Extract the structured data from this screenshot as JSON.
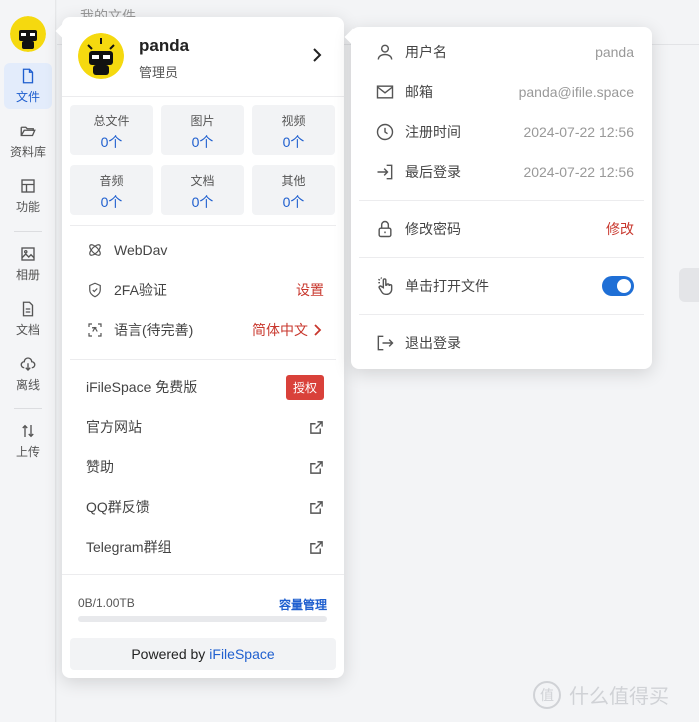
{
  "background": {
    "title_partial": "我的文件"
  },
  "sidebar": {
    "items": [
      {
        "label": "文件",
        "icon": "file-icon",
        "active": true
      },
      {
        "label": "资料库",
        "icon": "folder-open-icon"
      },
      {
        "label": "功能",
        "icon": "layout-icon"
      },
      {
        "label": "相册",
        "icon": "image-icon"
      },
      {
        "label": "文档",
        "icon": "document-icon"
      },
      {
        "label": "离线",
        "icon": "cloud-download-icon"
      },
      {
        "label": "上传",
        "icon": "sort-arrows-icon"
      }
    ]
  },
  "user": {
    "name": "panda",
    "role": "管理员"
  },
  "stats": [
    {
      "label": "总文件",
      "value": "0个"
    },
    {
      "label": "图片",
      "value": "0个"
    },
    {
      "label": "视频",
      "value": "0个"
    },
    {
      "label": "音频",
      "value": "0个"
    },
    {
      "label": "文档",
      "value": "0个"
    },
    {
      "label": "其他",
      "value": "0个"
    }
  ],
  "menu": {
    "webdav": "WebDav",
    "twofa": "2FA验证",
    "twofa_action": "设置",
    "language": "语言(待完善)",
    "language_value": "简体中文",
    "edition": "iFileSpace 免费版",
    "edition_badge": "授权",
    "official_site": "官方网站",
    "sponsor": "赞助",
    "qq_group": "QQ群反馈",
    "telegram": "Telegram群组"
  },
  "storage": {
    "usage": "0B/1.00TB",
    "manage": "容量管理",
    "fraction": 0
  },
  "powered": {
    "prefix": "Powered by",
    "brand": "iFileSpace"
  },
  "profile": {
    "username_label": "用户名",
    "username_value": "panda",
    "email_label": "邮箱",
    "email_value": "panda@ifile.space",
    "register_label": "注册时间",
    "register_value": "2024-07-22 12:56",
    "last_login_label": "最后登录",
    "last_login_value": "2024-07-22 12:56",
    "password_label": "修改密码",
    "password_action": "修改",
    "click_open_label": "单击打开文件",
    "click_open_enabled": true,
    "logout_label": "退出登录"
  },
  "watermark": "什么值得买",
  "colors": {
    "accent": "#1f5fcf",
    "danger": "#d9413a",
    "toggle_on": "#1f6fd6"
  }
}
